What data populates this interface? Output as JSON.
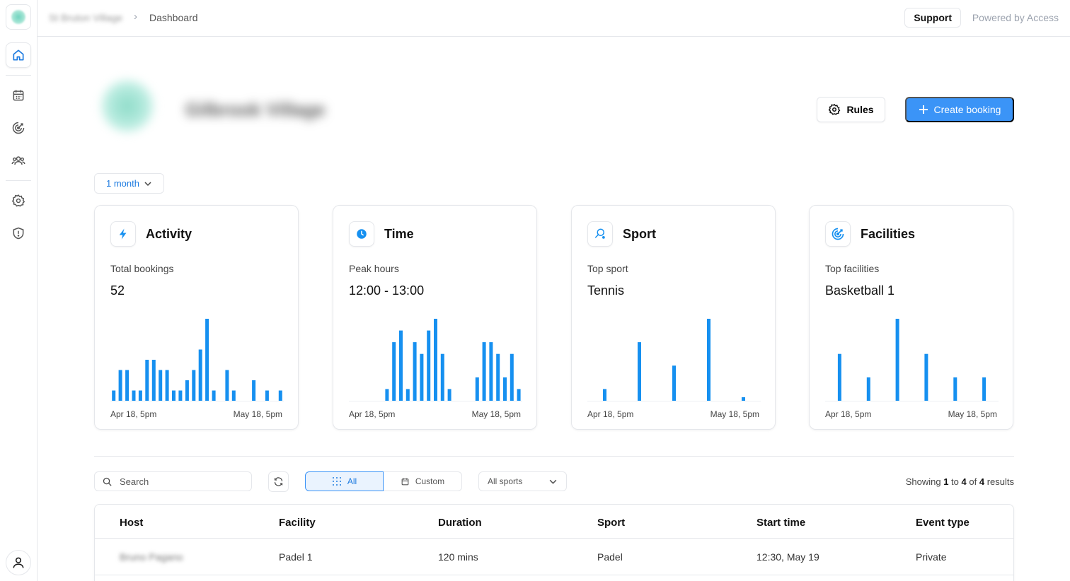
{
  "breadcrumb": {
    "org": "St Bruton Village",
    "separator": "›",
    "current": "Dashboard"
  },
  "topbar": {
    "support_label": "Support",
    "powered_by": "Powered by Access"
  },
  "sidebar": {
    "items": [
      {
        "name": "home",
        "icon": "home-icon",
        "active": true
      },
      {
        "name": "calendar",
        "icon": "calendar-icon",
        "active": false
      },
      {
        "name": "analytics",
        "icon": "target-icon",
        "active": false
      },
      {
        "name": "members",
        "icon": "users-icon",
        "active": false
      },
      {
        "name": "settings",
        "icon": "gear-icon",
        "active": false
      },
      {
        "name": "security",
        "icon": "shield-icon",
        "active": false
      }
    ],
    "user_icon": "user-icon"
  },
  "venue": {
    "name": "Gilbrook Village"
  },
  "actions": {
    "rules_label": "Rules",
    "create_label": "Create booking"
  },
  "period": {
    "selected": "1 month"
  },
  "colors": {
    "accent": "#3b94f7",
    "bar": "#1690f0",
    "active_text": "#1d7be0"
  },
  "cards": [
    {
      "title": "Activity",
      "icon": "bolt-icon",
      "label": "Total bookings",
      "value": "52",
      "x_start": "Apr 18, 5pm",
      "x_end": "May 18, 5pm"
    },
    {
      "title": "Time",
      "icon": "clock-icon",
      "label": "Peak hours",
      "value": "12:00 - 13:00",
      "x_start": "Apr 18, 5pm",
      "x_end": "May 18, 5pm"
    },
    {
      "title": "Sport",
      "icon": "racket-icon",
      "label": "Top sport",
      "value": "Tennis",
      "x_start": "Apr 18, 5pm",
      "x_end": "May 18, 5pm"
    },
    {
      "title": "Facilities",
      "icon": "target-icon",
      "label": "Top facilities",
      "value": "Basketball 1",
      "x_start": "Apr 18, 5pm",
      "x_end": "May 18, 5pm"
    }
  ],
  "chart_data": [
    {
      "type": "bar",
      "values": [
        1,
        3,
        3,
        1,
        1,
        4,
        4,
        3,
        3,
        1,
        1,
        2,
        3,
        5,
        8,
        1,
        0,
        3,
        1,
        0,
        0,
        2,
        0,
        1,
        0,
        1
      ]
    },
    {
      "type": "bar",
      "values": [
        0,
        0,
        0,
        0,
        0,
        1,
        5,
        6,
        1,
        5,
        4,
        6,
        7,
        4,
        1,
        0,
        0,
        0,
        2,
        5,
        5,
        4,
        2,
        4,
        1
      ]
    },
    {
      "type": "bar",
      "values": [
        1,
        5,
        3,
        7,
        0.3
      ]
    },
    {
      "type": "bar",
      "values": [
        4,
        2,
        7,
        4,
        2,
        2
      ]
    }
  ],
  "filters": {
    "search_placeholder": "Search",
    "segments": [
      "All",
      "Custom"
    ],
    "sports_selected": "All sports",
    "results": {
      "prefix": "Showing",
      "from": "1",
      "to_word": "to",
      "to": "4",
      "of_word": "of",
      "total": "4",
      "suffix": "results"
    }
  },
  "table": {
    "columns": [
      "Host",
      "Facility",
      "Duration",
      "Sport",
      "Start time",
      "Event type"
    ],
    "rows": [
      {
        "host": "Bruno Pagano",
        "facility": "Padel 1",
        "duration": "120 mins",
        "sport": "Padel",
        "start": "12:30, May 19",
        "event_type": "Private"
      }
    ]
  }
}
